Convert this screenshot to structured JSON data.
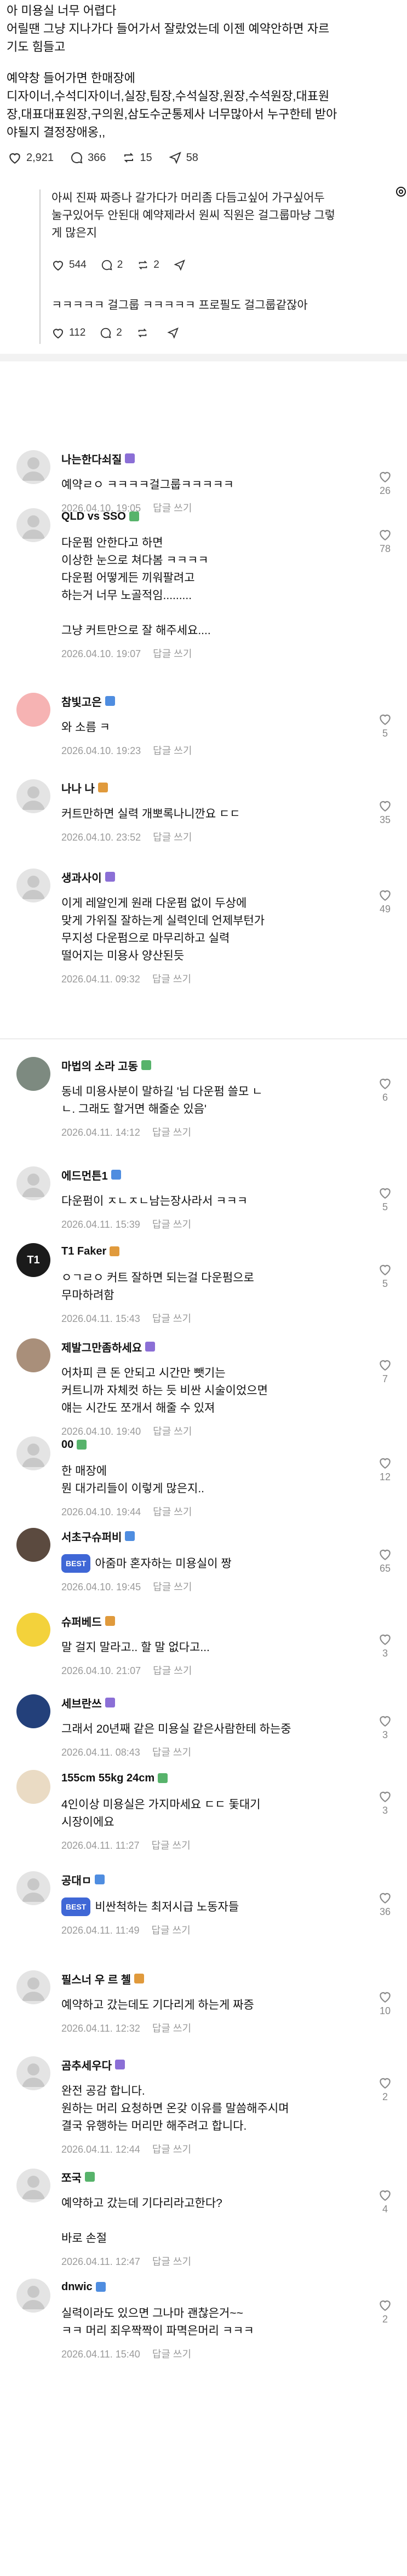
{
  "post": {
    "lines": [
      "아 미용실 너무 어렵다",
      "어릴땐 그냥 지나가다 들어가서 잘랐었는데 이젠 예약안하면 자르",
      "기도 힘들고",
      "",
      "예약창 들어가면 한매장에",
      "디자이너,수석디자이너,실장,팀장,수석실장,원장,수석원장,대표원",
      "장,대표대표원장,구의원,삼도수군통제사 너무많아서 누구한테 받아",
      "야될지 결정장애옹,,"
    ],
    "likes": "2,921",
    "comments": "366",
    "reposts": "15",
    "shares": "58"
  },
  "quote": {
    "lines": [
      "아씨 진짜 짜증나 갈가다가 머리좀 다듬고싶어 가구싶어두",
      "눌구있어두 안된대 예약제라서 원씨 직원은 걸그룹마냥 그렇",
      "게 많은지"
    ],
    "likes": "544",
    "comments": "2",
    "reposts": "2",
    "reply_text": "ㅋㅋㅋㅋㅋ 걸그룹 ㅋㅋㅋㅋㅋ 프로필도 걸그룹같잖아",
    "reply_likes": "112",
    "reply_comments": "2"
  },
  "comments": [
    {
      "name": "나는한다쇠질",
      "text": [
        "예약ㄹㅇ ㅋㅋㅋㅋ걸그룹ㅋㅋㅋㅋㅋ"
      ],
      "time": "2026.04.10. 19:05",
      "reply": "답글 쓰기",
      "likes": "26",
      "avatar": "gray-person"
    },
    {
      "name": "QLD vs SSO",
      "text": [
        "다운펌 안한다고 하면",
        "이상한 눈으로 쳐다봄 ㅋㅋㅋㅋ",
        "다운펌 어떻게든 끼워팔려고",
        "하는거 너무 노골적임.........",
        "",
        "그냥 커트만으로 잘 해주세요...."
      ],
      "time": "2026.04.10. 19:07",
      "reply": "답글 쓰기",
      "likes": "78",
      "avatar": "gray-person"
    },
    {
      "name": "참빛고은",
      "text": [
        "와 소름 ㅋ"
      ],
      "time": "2026.04.10. 19:23",
      "reply": "답글 쓰기",
      "likes": "5",
      "avatar": "pink"
    },
    {
      "name": "나나 나",
      "text": [
        "커트만하면 실력 개뽀록나니깐요 ㄷㄷ"
      ],
      "time": "2026.04.10. 23:52",
      "reply": "답글 쓰기",
      "likes": "35",
      "avatar": "gray-person"
    },
    {
      "name": "생과사이",
      "text": [
        "이게 레알인게 원래 다운펌 없이 두상에",
        "맞게 가위질 잘하는게 실력인데 언제부턴가",
        "무지성 다운펌으로 마무리하고 실력",
        "떨어지는 미용사 양산된듯"
      ],
      "time": "2026.04.11. 09:32",
      "reply": "답글 쓰기",
      "likes": "49",
      "avatar": "gray-person"
    },
    {
      "name": "마법의 소라 고동",
      "text": [
        "동네 미용사분이 말하길 '님 다운펌 쓸모 ㄴ",
        "ㄴ. 그래도 할거면 해줄순 있음'"
      ],
      "time": "2026.04.11. 14:12",
      "reply": "답글 쓰기",
      "likes": "6",
      "avatar": "photo-gray"
    },
    {
      "name": "에드먼튼1",
      "text": [
        "다운펌이 ㅈㄴㅈㄴ남는장사라서 ㅋㅋㅋ"
      ],
      "time": "2026.04.11. 15:39",
      "reply": "답글 쓰기",
      "likes": "5",
      "avatar": "gray-person"
    },
    {
      "name": "T1 Faker",
      "text": [
        "ㅇㄱㄹㅇ 커트 잘하면 되는걸 다운펌으로",
        "무마하려함"
      ],
      "time": "2026.04.11. 15:43",
      "reply": "답글 쓰기",
      "likes": "5",
      "avatar": "t1"
    },
    {
      "name": "제발그만좀하세요",
      "text": [
        "어차피 큰 돈 안되고 시간만 뺏기는",
        "커트니까 자체컷 하는 듯 비싼 시술이었으면",
        "얘는 시간도 쪼개서 해줄 수 있져"
      ],
      "time": "2026.04.10. 19:40",
      "reply": "답글 쓰기",
      "likes": "7",
      "avatar": "photo-face"
    },
    {
      "name": "00",
      "text": [
        "한 매장에",
        "뭔 대가리들이 이렇게 많은지.."
      ],
      "time": "2026.04.10. 19:44",
      "reply": "답글 쓰기",
      "likes": "12",
      "avatar": "gray-person"
    },
    {
      "name": "서초구슈퍼비",
      "best": "BEST",
      "text": [
        "아줌마 혼자하는 미용실이 짱"
      ],
      "time": "2026.04.10. 19:45",
      "reply": "답글 쓰기",
      "likes": "65",
      "avatar": "photo-face2"
    },
    {
      "name": "슈퍼베드",
      "text": [
        "말 걸지 말라고.. 할 말 없다고..."
      ],
      "time": "2026.04.10. 21:07",
      "reply": "답글 쓰기",
      "likes": "3",
      "avatar": "minion"
    },
    {
      "name": "세브란쓰",
      "text": [
        "그래서 20년째 같은 미용실 같은사람한테 하는중"
      ],
      "time": "2026.04.11. 08:43",
      "reply": "답글 쓰기",
      "likes": "3",
      "avatar": "navy"
    },
    {
      "name": "155cm 55kg 24cm",
      "text": [
        "4인이상 미용실은 가지마세요 ㄷㄷ 돛대기",
        "시장이에요"
      ],
      "time": "2026.04.11. 11:27",
      "reply": "답글 쓰기",
      "likes": "3",
      "avatar": "cartoon"
    },
    {
      "name": "공대ㅁ",
      "best": "BEST",
      "text": [
        "비싼척하는 최저시급 노동자들"
      ],
      "time": "2026.04.11. 11:49",
      "reply": "답글 쓰기",
      "likes": "36",
      "avatar": "gray-person"
    },
    {
      "name": "필스너 우 르 첼",
      "text": [
        "예약하고 갔는데도 기다리게 하는게 짜증"
      ],
      "time": "2026.04.11. 12:32",
      "reply": "답글 쓰기",
      "likes": "10",
      "avatar": "gray-person"
    },
    {
      "name": "곰추세우다",
      "text": [
        "완전 공감 합니다.",
        "원하는 머리 요청하면 온갖 이유를 말씀해주시며",
        "결국 유행하는 머리만 해주려고 합니다."
      ],
      "time": "2026.04.11. 12:44",
      "reply": "답글 쓰기",
      "likes": "2",
      "avatar": "gray-person"
    },
    {
      "name": "쪼국",
      "text": [
        "예약하고 갔는데 기다리라고한다?",
        "",
        "바로 손절"
      ],
      "time": "2026.04.11. 12:47",
      "reply": "답글 쓰기",
      "likes": "4",
      "avatar": "gray-person"
    },
    {
      "name": "dnwic",
      "text": [
        "실력이라도 있으면 그나마 괜찮은거~~",
        "ㅋㅋ 머리 죄우짝짝이 파멱은머리 ㅋㅋㅋ"
      ],
      "time": "2026.04.11. 15:40",
      "reply": "답글 쓰기",
      "likes": "2",
      "avatar": "gray-person"
    }
  ]
}
